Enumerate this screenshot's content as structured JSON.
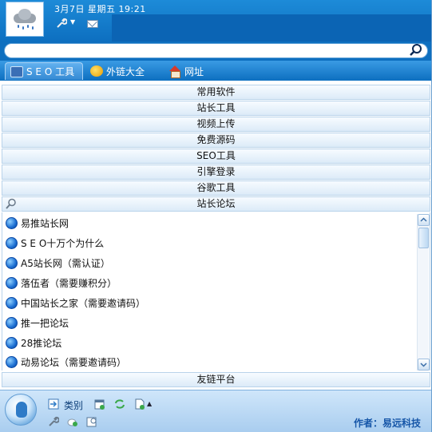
{
  "header": {
    "date_time": "3月7日 星期五 19:21"
  },
  "search": {
    "placeholder": ""
  },
  "tabs": [
    {
      "label": "S E O 工具",
      "active": true
    },
    {
      "label": "外链大全",
      "active": false
    },
    {
      "label": "网址",
      "active": false
    }
  ],
  "categories": [
    "常用软件",
    "站长工具",
    "视频上传",
    "免费源码",
    "SEO工具",
    "引擎登录",
    "谷歌工具",
    "站长论坛"
  ],
  "list_items": [
    "易推站长网",
    "S E O十万个为什么",
    "A5站长网（需认证）",
    "落伍者（需要赚积分）",
    "中国站长之家（需要邀请码）",
    "推一把论坛",
    "28推论坛",
    "动易论坛（需要邀请码）"
  ],
  "footer_category": "友链平台",
  "bottom": {
    "category_label": "类别",
    "author": "作者：易远科技"
  },
  "colors": {
    "header": "#0d6fc0",
    "accent": "#1656a8"
  }
}
